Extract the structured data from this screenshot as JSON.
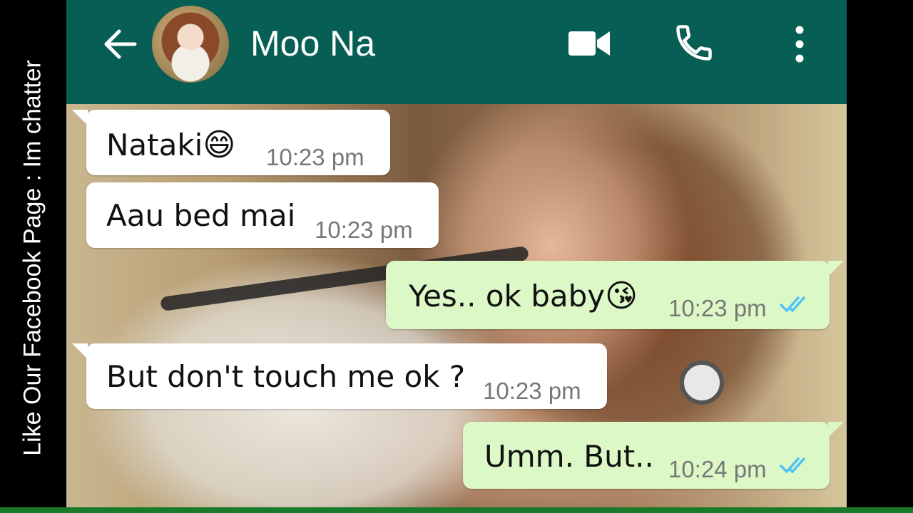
{
  "side_banner": {
    "text": "Like Our Facebook Page : Im chatter"
  },
  "header": {
    "contact_name": "Moo Na",
    "back_icon": "arrow-left-icon",
    "video_icon": "video-camera-icon",
    "call_icon": "phone-icon",
    "menu_icon": "more-vertical-icon",
    "color": "#075e54"
  },
  "messages": [
    {
      "direction": "incoming",
      "text": "Nataki",
      "emoji": "😄",
      "time": "10:23 pm"
    },
    {
      "direction": "incoming",
      "text": "Aau bed mai",
      "emoji": "",
      "time": "10:23 pm"
    },
    {
      "direction": "outgoing",
      "text": "Yes.. ok baby",
      "emoji": "😘",
      "time": "10:23 pm",
      "status": "read"
    },
    {
      "direction": "incoming",
      "text": "But don't touch me ok ?",
      "emoji": "",
      "time": "10:23 pm"
    },
    {
      "direction": "outgoing",
      "text": "Umm. But..",
      "emoji": "",
      "time": "10:24 pm",
      "status": "read"
    }
  ],
  "colors": {
    "incoming_bubble": "#ffffff",
    "outgoing_bubble": "#dcf8c6",
    "read_ticks": "#4fc3f7"
  }
}
